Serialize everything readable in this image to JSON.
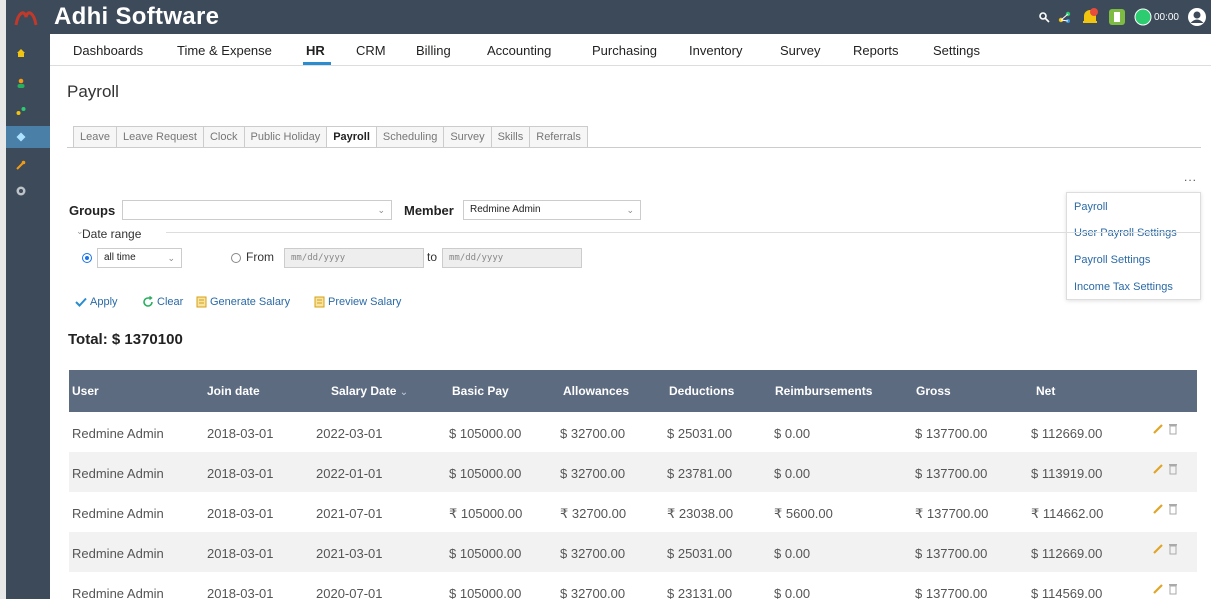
{
  "app": {
    "title": "Adhi Software",
    "timer": "00:00",
    "colors": {
      "topbar": "#3d4a5a",
      "accent": "#2b8ccf",
      "table_header": "#5d6b80",
      "link": "#2a6aa6"
    }
  },
  "sidebar_icons": [
    "home-icon",
    "user-icon",
    "share-icon",
    "hr-icon",
    "wrench-icon",
    "help-icon"
  ],
  "nav": {
    "items": [
      "Dashboards",
      "Time & Expense",
      "HR",
      "CRM",
      "Billing",
      "Accounting",
      "Purchasing",
      "Inventory",
      "Survey",
      "Reports",
      "Settings"
    ],
    "active": "HR"
  },
  "page": {
    "title": "Payroll"
  },
  "tabs": {
    "items": [
      "Leave",
      "Leave Request",
      "Clock",
      "Public Holiday",
      "Payroll",
      "Scheduling",
      "Survey",
      "Skills",
      "Referrals"
    ],
    "active": "Payroll"
  },
  "more_menu": {
    "trigger": "...",
    "items": [
      "Payroll",
      "User Payroll Settings",
      "Payroll Settings",
      "Income Tax Settings"
    ]
  },
  "filters": {
    "groups_label": "Groups",
    "groups_value": "",
    "member_label": "Member",
    "member_value": "Redmine Admin",
    "date_range_label": "Date range",
    "period_value": "all time",
    "from_label": "From",
    "to_label": "to",
    "from_placeholder": "mm/dd/yyyy",
    "to_placeholder": "mm/dd/yyyy"
  },
  "actions": {
    "apply": "Apply",
    "clear": "Clear",
    "generate": "Generate Salary",
    "preview": "Preview Salary"
  },
  "summary": {
    "total": "Total: $ 1370100"
  },
  "table": {
    "columns": [
      "User",
      "Join date",
      "Salary Date",
      "Basic Pay",
      "Allowances",
      "Deductions",
      "Reimbursements",
      "Gross",
      "Net"
    ],
    "sorted_column": "Salary Date",
    "rows": [
      [
        "Redmine Admin",
        "2018-03-01",
        "2022-03-01",
        "$ 105000.00",
        "$ 32700.00",
        "$ 25031.00",
        "$ 0.00",
        "$ 137700.00",
        "$ 112669.00"
      ],
      [
        "Redmine Admin",
        "2018-03-01",
        "2022-01-01",
        "$ 105000.00",
        "$ 32700.00",
        "$ 23781.00",
        "$ 0.00",
        "$ 137700.00",
        "$ 113919.00"
      ],
      [
        "Redmine Admin",
        "2018-03-01",
        "2021-07-01",
        "₹ 105000.00",
        "₹ 32700.00",
        "₹ 23038.00",
        "₹ 5600.00",
        "₹ 137700.00",
        "₹ 114662.00"
      ],
      [
        "Redmine Admin",
        "2018-03-01",
        "2021-03-01",
        "$ 105000.00",
        "$ 32700.00",
        "$ 25031.00",
        "$ 0.00",
        "$ 137700.00",
        "$ 112669.00"
      ],
      [
        "Redmine Admin",
        "2018-03-01",
        "2020-07-01",
        "$ 105000.00",
        "$ 32700.00",
        "$ 23131.00",
        "$ 0.00",
        "$ 137700.00",
        "$ 114569.00"
      ]
    ]
  }
}
